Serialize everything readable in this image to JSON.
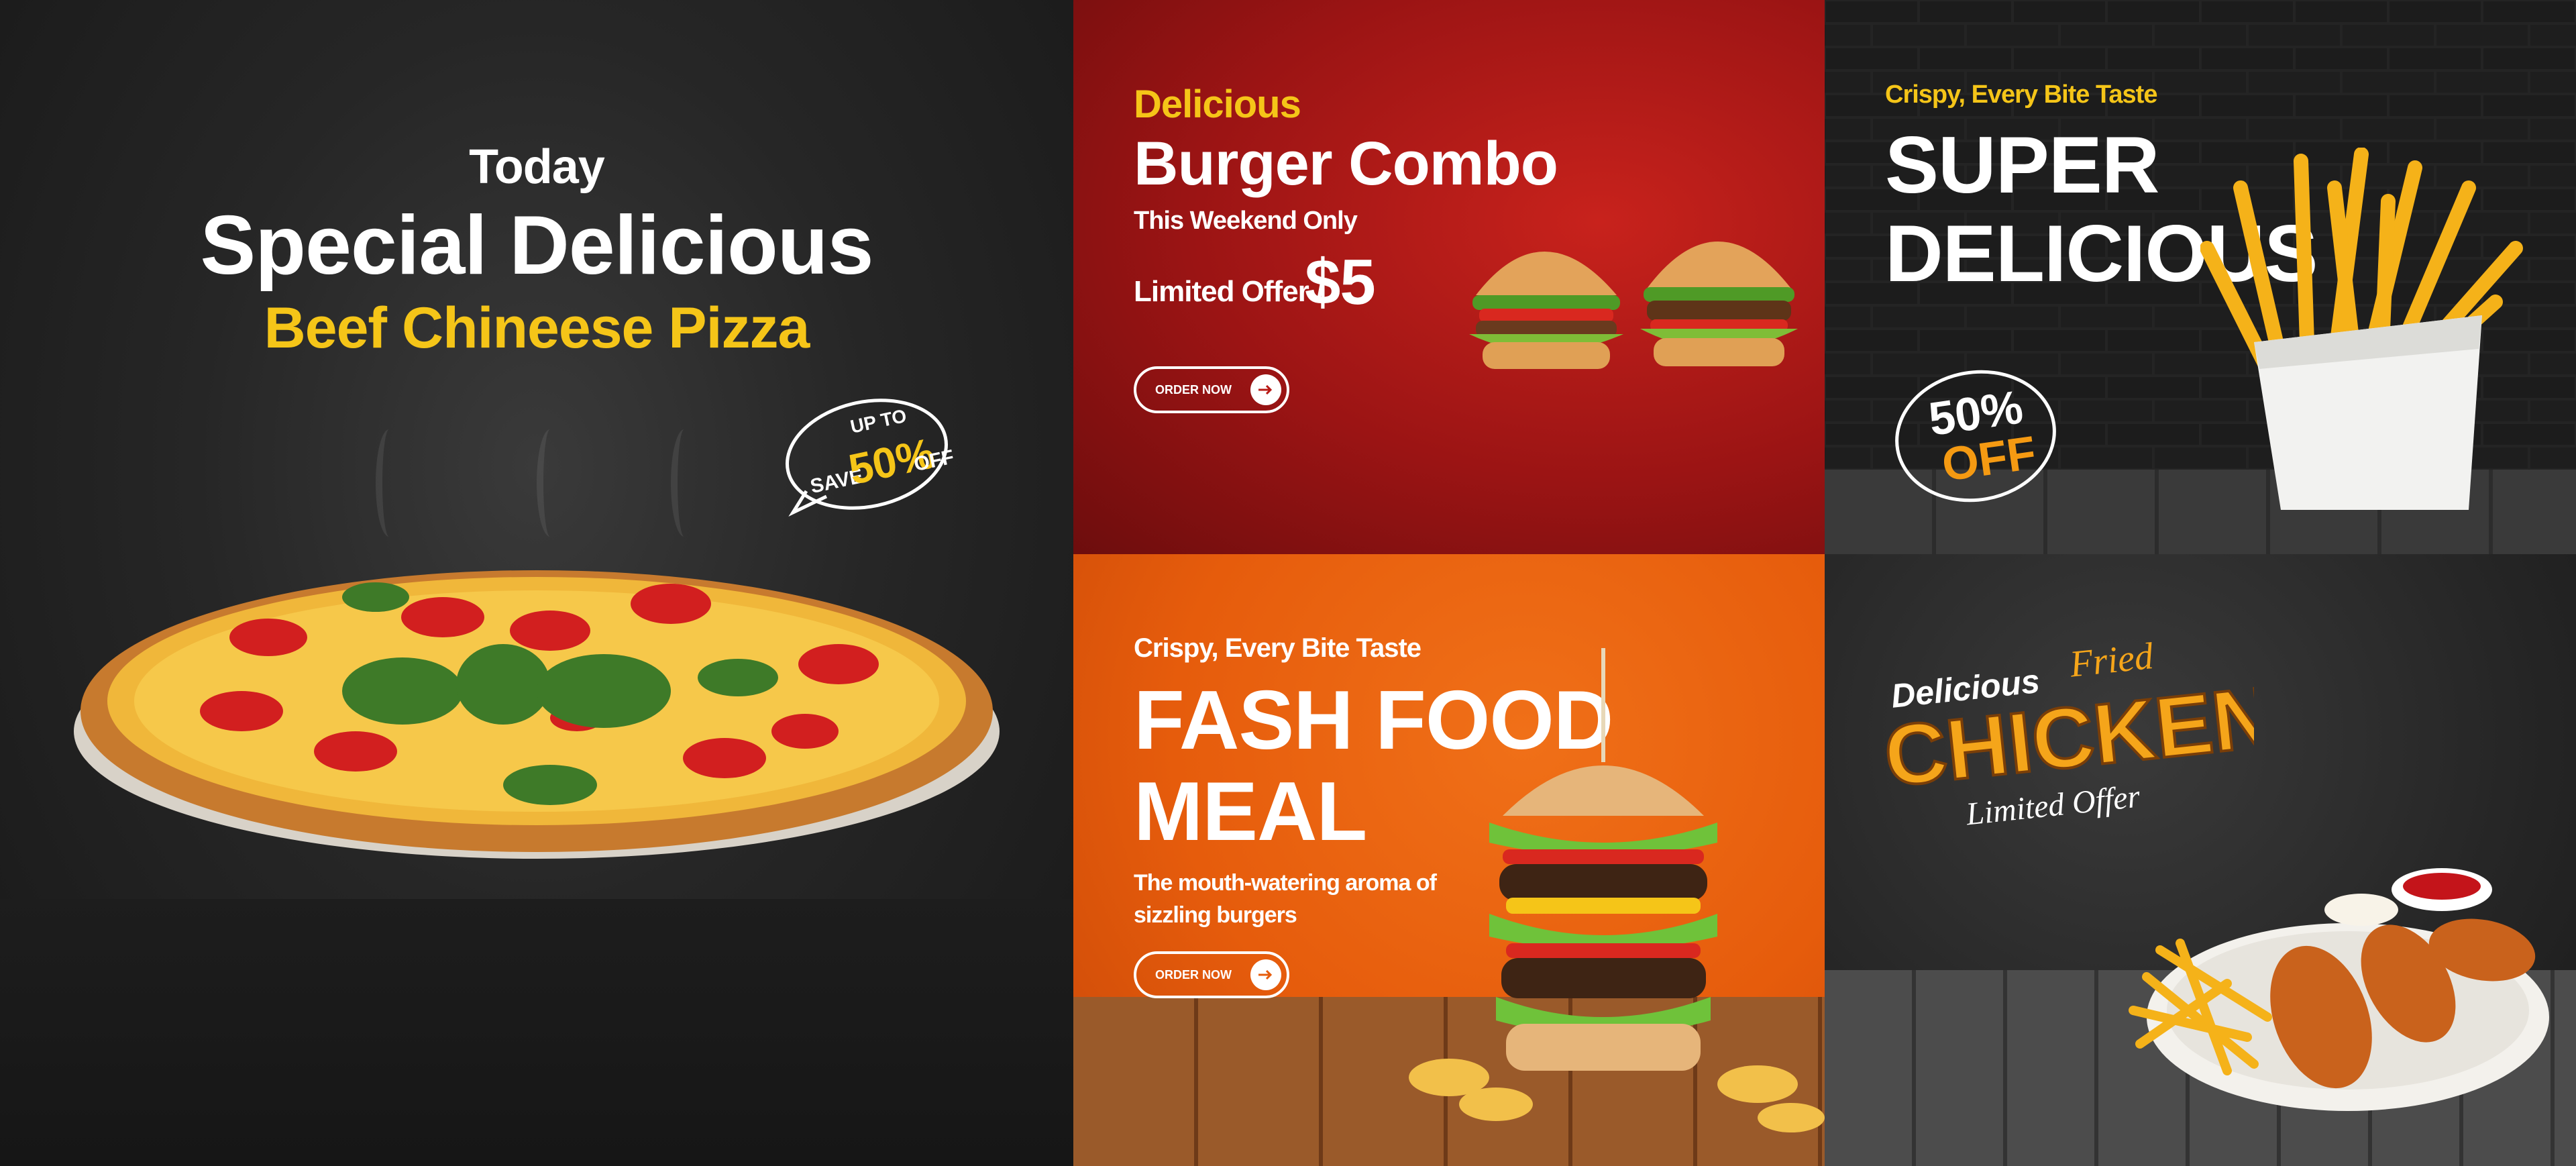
{
  "pizza_panel": {
    "today": "Today",
    "title": "Special Delicious",
    "subtitle": "Beef Chineese Pizza",
    "badge": {
      "line1": "UP TO",
      "line2": "SAVE",
      "percent": "50%",
      "off": "OFF"
    }
  },
  "burger_panel": {
    "tag": "Delicious",
    "title": "Burger Combo",
    "note": "This Weekend Only",
    "limited": "Limited Offer /",
    "price": "$5",
    "button": "ORDER NOW"
  },
  "fries_panel": {
    "tag": "Crispy, Every Bite Taste",
    "title_line1": "SUPER",
    "title_line2": "DELICIOUS",
    "badge_percent": "50%",
    "badge_off": "OFF"
  },
  "fastfood_panel": {
    "tag": "Crispy, Every Bite Taste",
    "title_line1": "FASH FOOD",
    "title_line2": "MEAL",
    "desc_line1": "The mouth-watering aroma of",
    "desc_line2": "sizzling burgers",
    "button": "ORDER NOW"
  },
  "chicken_panel": {
    "delicious": "Delicious",
    "fried": "Fried",
    "chicken": "CHICKEN",
    "limited": "Limited Offer"
  },
  "colors": {
    "accent_yellow": "#f5c518",
    "red": "#b81a16",
    "orange": "#e65c0c"
  }
}
